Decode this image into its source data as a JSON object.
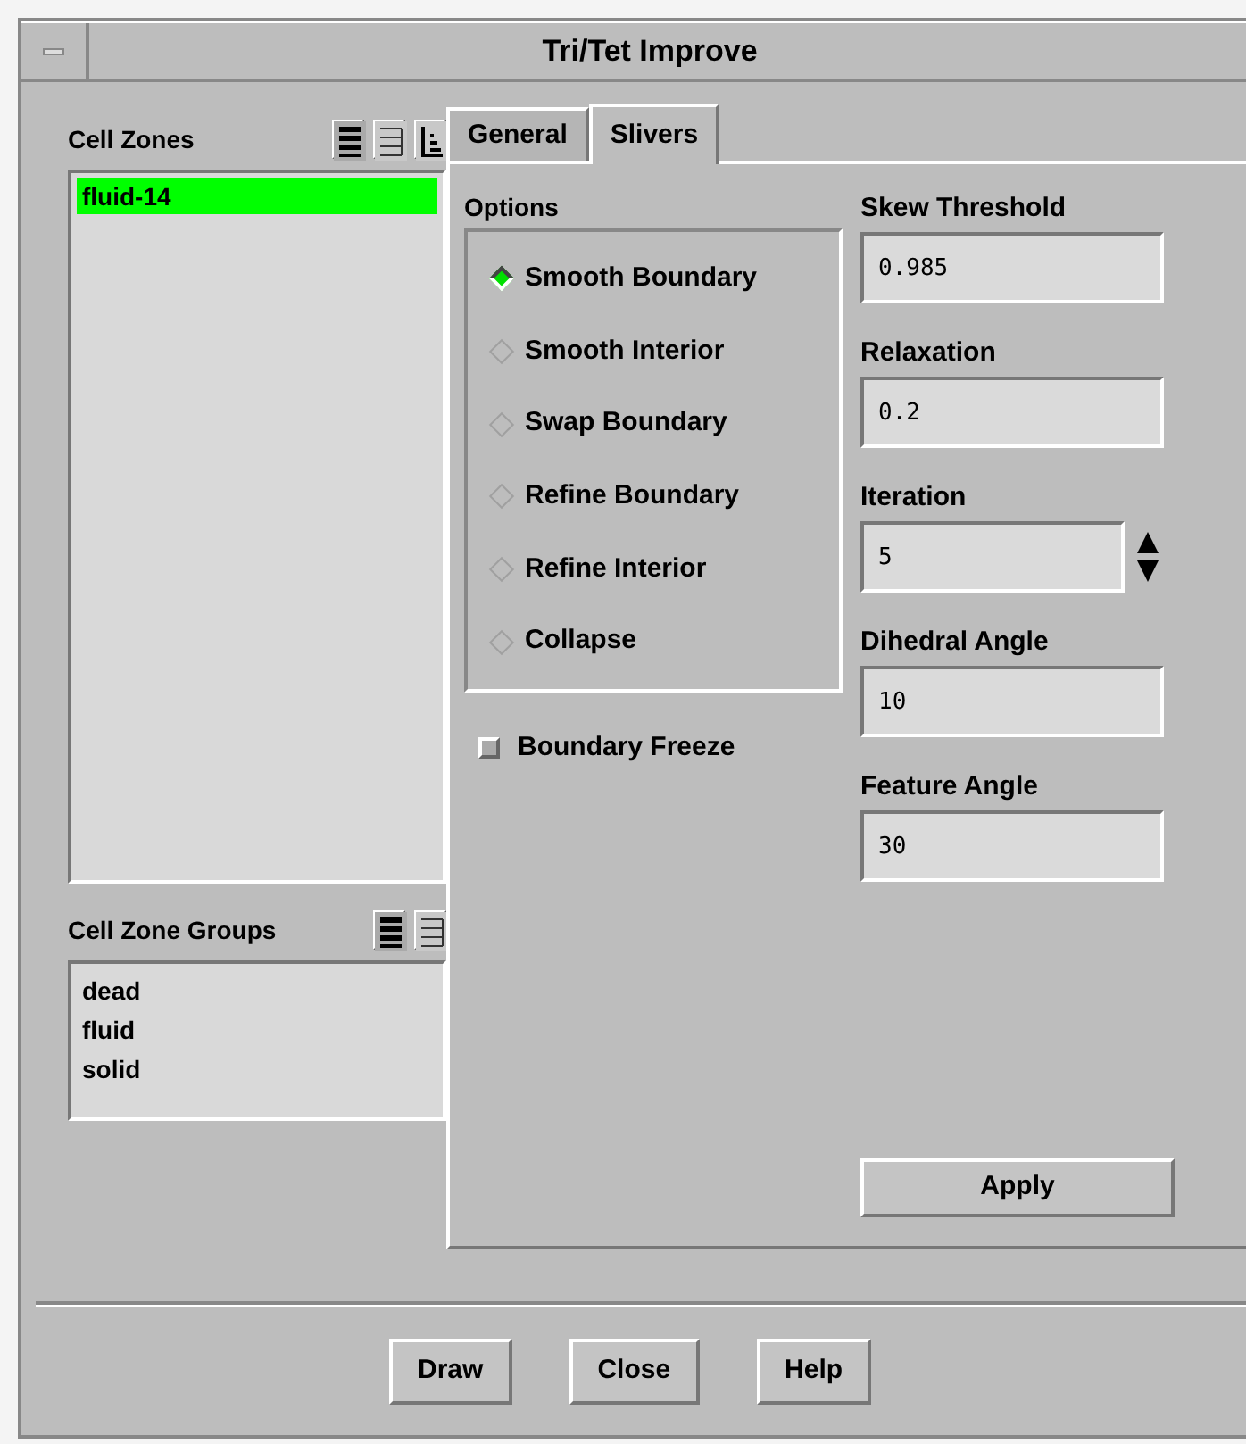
{
  "window": {
    "title": "Tri/Tet Improve"
  },
  "cell_zones": {
    "label": "Cell Zones",
    "items": [
      {
        "label": "fluid-14",
        "selected": true
      }
    ]
  },
  "cell_zone_groups": {
    "label": "Cell Zone Groups",
    "items": [
      {
        "label": "dead",
        "selected": false
      },
      {
        "label": "fluid",
        "selected": false
      },
      {
        "label": "solid",
        "selected": false
      }
    ]
  },
  "tabs": [
    {
      "label": "General",
      "selected": false
    },
    {
      "label": "Slivers",
      "selected": true
    }
  ],
  "options": {
    "label": "Options",
    "items": [
      {
        "label": "Smooth Boundary",
        "selected": true
      },
      {
        "label": "Smooth Interior",
        "selected": false
      },
      {
        "label": "Swap Boundary",
        "selected": false
      },
      {
        "label": "Refine Boundary",
        "selected": false
      },
      {
        "label": "Refine Interior",
        "selected": false
      },
      {
        "label": "Collapse",
        "selected": false
      }
    ]
  },
  "boundary_freeze": {
    "label": "Boundary Freeze",
    "checked": false
  },
  "fields": [
    {
      "label": "Skew Threshold",
      "value": "0.985",
      "kind": "text"
    },
    {
      "label": "Relaxation",
      "value": "0.2",
      "kind": "text"
    },
    {
      "label": "Iteration",
      "value": "5",
      "kind": "spinner"
    },
    {
      "label": "Dihedral Angle",
      "value": "10",
      "kind": "text"
    },
    {
      "label": "Feature Angle",
      "value": "30",
      "kind": "text"
    }
  ],
  "apply_button": "Apply",
  "buttons": [
    "Draw",
    "Close",
    "Help"
  ]
}
